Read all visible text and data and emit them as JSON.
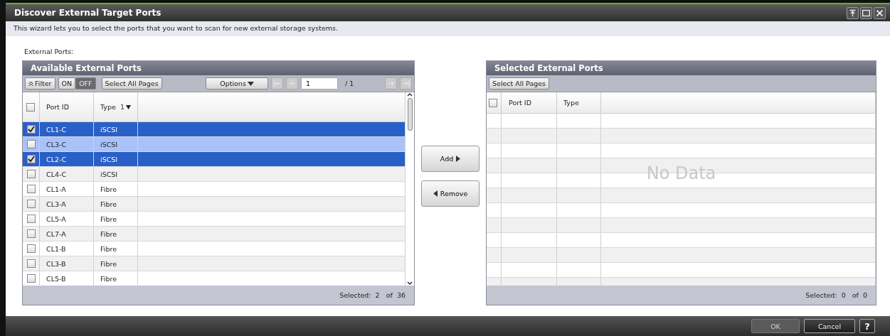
{
  "window": {
    "title": "Discover External Target Ports"
  },
  "description": "This wizard lets you to select the ports that you want to scan for new external storage systems.",
  "section_label": "External Ports:",
  "available": {
    "title": "Available External Ports",
    "toolbar": {
      "filter": "Filter",
      "filter_toggle": [
        {
          "label": "ON",
          "selected": false
        },
        {
          "label": "OFF",
          "selected": true
        }
      ],
      "select_all": "Select All Pages",
      "options": "Options",
      "page": "1",
      "page_total": "/ 1"
    },
    "columns": [
      {
        "label": "Port ID"
      },
      {
        "label": "Type",
        "sort": "1"
      }
    ],
    "all_checked": false,
    "rows": [
      {
        "port_id": "CL1-C",
        "type": "iSCSI",
        "checked": true,
        "selected": true,
        "highlighted": false
      },
      {
        "port_id": "CL3-C",
        "type": "iSCSI",
        "checked": false,
        "selected": false,
        "highlighted": true
      },
      {
        "port_id": "CL2-C",
        "type": "iSCSI",
        "checked": true,
        "selected": true,
        "highlighted": false
      },
      {
        "port_id": "CL4-C",
        "type": "iSCSI",
        "checked": false,
        "selected": false,
        "highlighted": false
      },
      {
        "port_id": "CL1-A",
        "type": "Fibre",
        "checked": false,
        "selected": false,
        "highlighted": false
      },
      {
        "port_id": "CL3-A",
        "type": "Fibre",
        "checked": false,
        "selected": false,
        "highlighted": false
      },
      {
        "port_id": "CL5-A",
        "type": "Fibre",
        "checked": false,
        "selected": false,
        "highlighted": false
      },
      {
        "port_id": "CL7-A",
        "type": "Fibre",
        "checked": false,
        "selected": false,
        "highlighted": false
      },
      {
        "port_id": "CL1-B",
        "type": "Fibre",
        "checked": false,
        "selected": false,
        "highlighted": false
      },
      {
        "port_id": "CL3-B",
        "type": "Fibre",
        "checked": false,
        "selected": false,
        "highlighted": false
      },
      {
        "port_id": "CL5-B",
        "type": "Fibre",
        "checked": false,
        "selected": false,
        "highlighted": false
      }
    ],
    "footer": "Selected:  2   of  36"
  },
  "move_buttons": [
    {
      "label": "Add",
      "kind": "add"
    },
    {
      "label": "Remove",
      "kind": "remove"
    }
  ],
  "selected": {
    "title": "Selected External Ports",
    "select_all": "Select All Pages",
    "columns": [
      {
        "label": "Port ID"
      },
      {
        "label": "Type"
      }
    ],
    "all_checked": false,
    "empty_text": "No Data",
    "footer": "Selected:  0   of  0"
  },
  "buttons": [
    {
      "label": "OK",
      "disabled": true
    },
    {
      "label": "Cancel",
      "disabled": false
    }
  ],
  "help": "?"
}
